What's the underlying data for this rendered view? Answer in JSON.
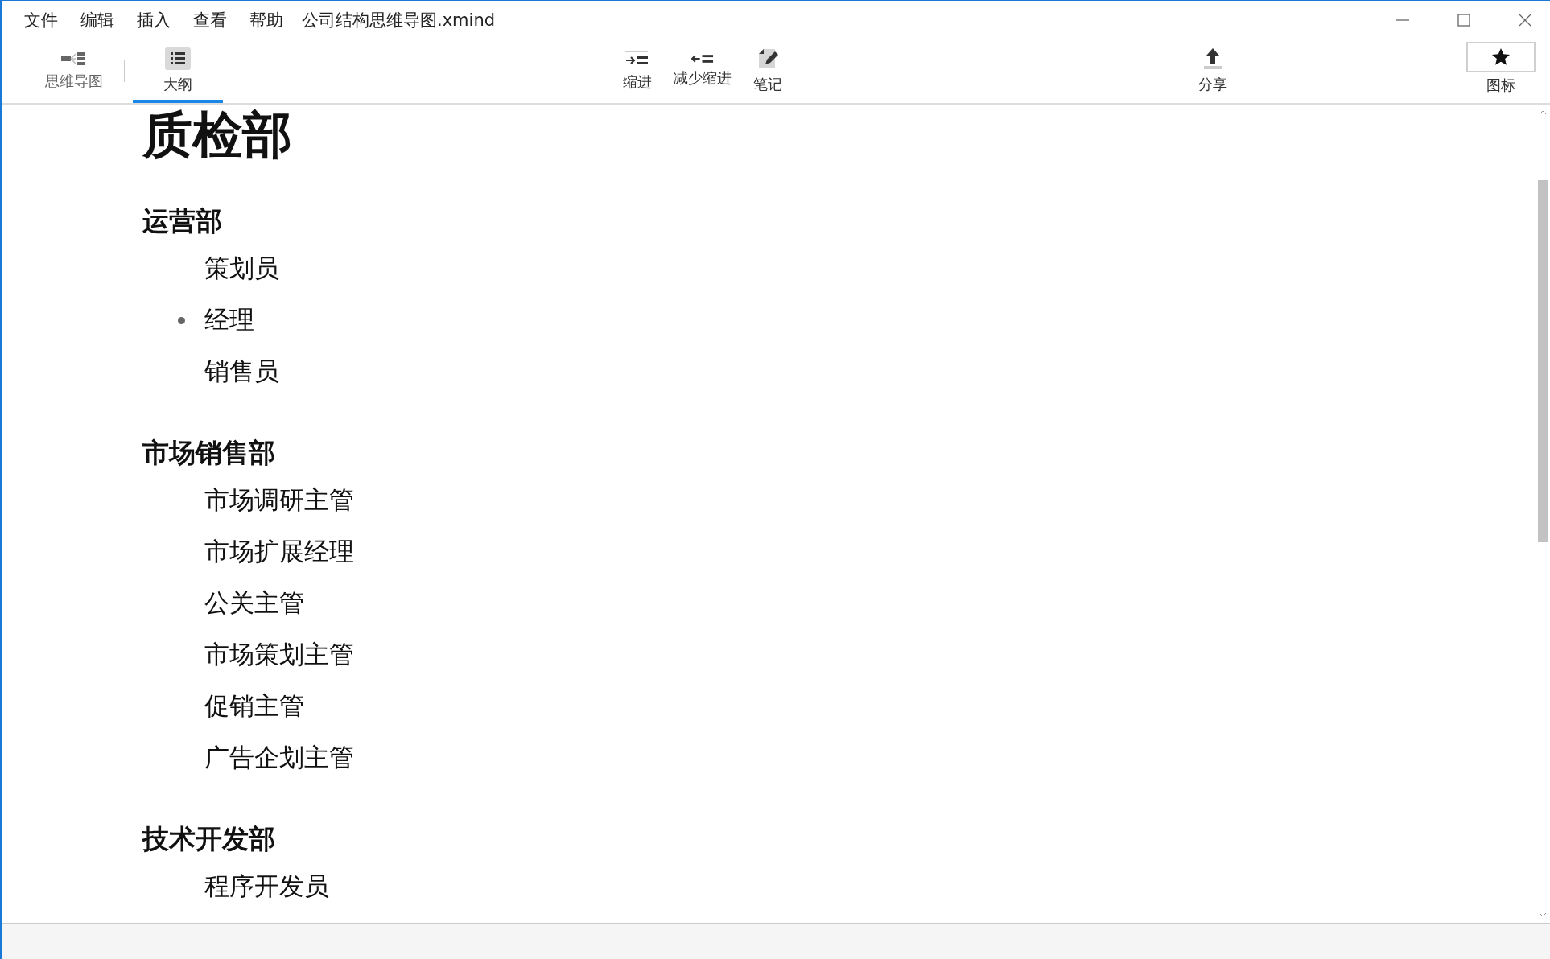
{
  "menu": [
    "文件",
    "编辑",
    "插入",
    "查看",
    "帮助"
  ],
  "window": {
    "title": "公司结构思维导图.xmind"
  },
  "view_tabs": [
    {
      "label": "思维导图",
      "kind": "mindmap",
      "selected": false
    },
    {
      "label": "大纲",
      "kind": "outline",
      "selected": true
    }
  ],
  "tools": [
    {
      "label": "缩进",
      "kind": "indent"
    },
    {
      "label": "减少缩进",
      "kind": "outdent"
    },
    {
      "label": "笔记",
      "kind": "note"
    }
  ],
  "share": {
    "label": "分享"
  },
  "icons_button": {
    "label": "图标"
  },
  "outline": {
    "title": "质检部",
    "sections": [
      {
        "heading": "运营部",
        "items": [
          {
            "label": "策划员",
            "selected": false
          },
          {
            "label": "经理",
            "selected": true
          },
          {
            "label": "销售员",
            "selected": false
          }
        ]
      },
      {
        "heading": "市场销售部",
        "items": [
          {
            "label": "市场调研主管",
            "selected": false
          },
          {
            "label": "市场扩展经理",
            "selected": false
          },
          {
            "label": "公关主管",
            "selected": false
          },
          {
            "label": "市场策划主管",
            "selected": false
          },
          {
            "label": "促销主管",
            "selected": false
          },
          {
            "label": "广告企划主管",
            "selected": false
          }
        ]
      },
      {
        "heading": "技术开发部",
        "items": [
          {
            "label": "程序开发员",
            "selected": false
          }
        ]
      }
    ]
  }
}
